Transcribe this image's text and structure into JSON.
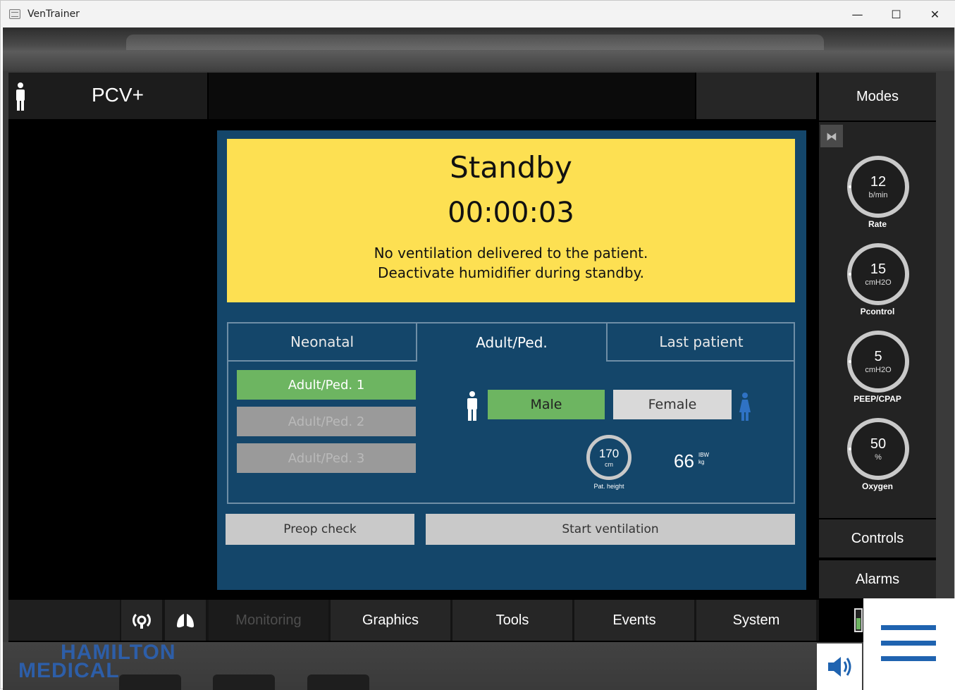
{
  "window": {
    "title": "VenTrainer",
    "controls": {
      "minimize": "—",
      "maximize": "☐",
      "close": "✕"
    }
  },
  "header": {
    "mode": "PCV+",
    "modes_button": "Modes"
  },
  "standby": {
    "title": "Standby",
    "timer": "00:00:03",
    "message_line1": "No ventilation delivered to the patient.",
    "message_line2": "Deactivate humidifier during standby."
  },
  "patient_tabs": [
    "Neonatal",
    "Adult/Ped.",
    "Last patient"
  ],
  "patient_presets": [
    {
      "label": "Adult/Ped. 1",
      "state": "selected"
    },
    {
      "label": "Adult/Ped. 2",
      "state": "disabled"
    },
    {
      "label": "Adult/Ped. 3",
      "state": "disabled"
    }
  ],
  "gender": {
    "male": "Male",
    "female": "Female",
    "selected": "male"
  },
  "height": {
    "value": "170",
    "unit": "cm",
    "label": "Pat. height"
  },
  "ibw": {
    "value": "66",
    "label1": "IBW",
    "label2": "kg"
  },
  "actions": {
    "preop": "Preop check",
    "start": "Start ventilation"
  },
  "settings": [
    {
      "value": "12",
      "unit": "b/min",
      "label": "Rate"
    },
    {
      "value": "15",
      "unit": "cmH2O",
      "label": "Pcontrol"
    },
    {
      "value": "5",
      "unit": "cmH2O",
      "label": "PEEP/CPAP"
    },
    {
      "value": "50",
      "unit": "%",
      "label": "Oxygen"
    }
  ],
  "side_buttons": {
    "controls": "Controls",
    "alarms": "Alarms"
  },
  "bottom_tabs": {
    "monitoring": "Monitoring",
    "graphics": "Graphics",
    "tools": "Tools",
    "events": "Events",
    "system": "System"
  },
  "brand": {
    "line1": "HAMILTON",
    "line2": "MEDICAL"
  },
  "colors": {
    "standby_bg": "#fde052",
    "dialog_bg": "#14466a",
    "selected_green": "#6db561",
    "accent_blue": "#1f63b0"
  }
}
